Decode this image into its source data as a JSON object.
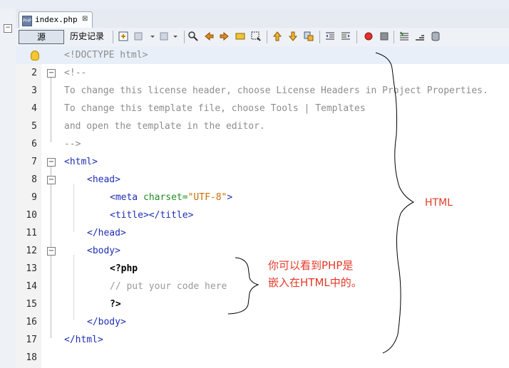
{
  "tab": {
    "title": "index.php",
    "close": "⊠"
  },
  "toolbar": {
    "source_label": "源",
    "history_label": "历史记录"
  },
  "lines": [
    {
      "num": "1",
      "text": "<!DOCTYPE html>",
      "kind": "comment",
      "indent": 0,
      "fold": "",
      "highlighted": true,
      "hint_bulb": true
    },
    {
      "num": "2",
      "text": "<!--",
      "kind": "comment",
      "indent": 0,
      "fold": "−"
    },
    {
      "num": "3",
      "text": "To change this license header, choose License Headers in Project Properties.",
      "kind": "comment",
      "indent": 0,
      "fold": ""
    },
    {
      "num": "4",
      "text": "To change this template file, choose Tools | Templates",
      "kind": "comment",
      "indent": 0,
      "fold": ""
    },
    {
      "num": "5",
      "text": "and open the template in the editor.",
      "kind": "comment",
      "indent": 0,
      "fold": ""
    },
    {
      "num": "6",
      "text": "-->",
      "kind": "comment",
      "indent": 0,
      "fold": ""
    },
    {
      "num": "7",
      "text": "<html>",
      "kind": "tag",
      "indent": 0,
      "fold": "−"
    },
    {
      "num": "8",
      "text": "<head>",
      "kind": "tag",
      "indent": 1,
      "fold": "−"
    },
    {
      "num": "9",
      "text": "<meta charset=\"UTF-8\">",
      "kind": "meta",
      "indent": 2,
      "fold": ""
    },
    {
      "num": "10",
      "text": "<title></title>",
      "kind": "tag",
      "indent": 2,
      "fold": ""
    },
    {
      "num": "11",
      "text": "</head>",
      "kind": "tag",
      "indent": 1,
      "fold": ""
    },
    {
      "num": "12",
      "text": "<body>",
      "kind": "tag",
      "indent": 1,
      "fold": "−"
    },
    {
      "num": "13",
      "text": "<?php",
      "kind": "php",
      "indent": 2,
      "fold": ""
    },
    {
      "num": "14",
      "text": "// put your code here",
      "kind": "phpcomment",
      "indent": 2,
      "fold": ""
    },
    {
      "num": "15",
      "text": "?>",
      "kind": "php",
      "indent": 2,
      "fold": ""
    },
    {
      "num": "16",
      "text": "</body>",
      "kind": "tag",
      "indent": 1,
      "fold": ""
    },
    {
      "num": "17",
      "text": "</html>",
      "kind": "tag",
      "indent": 0,
      "fold": ""
    },
    {
      "num": "18",
      "text": "",
      "kind": "tag",
      "indent": 0,
      "fold": ""
    }
  ],
  "annotations": {
    "html_label": "HTML",
    "php_note_line1": "你可以看到PHP是",
    "php_note_line2": "嵌入在HTML中的。"
  },
  "colors": {
    "tag": "#1f2eb4",
    "comment": "#8d8d8d",
    "attr": "#238c23",
    "value": "#cc6d00",
    "annotation": "#e23a28"
  }
}
